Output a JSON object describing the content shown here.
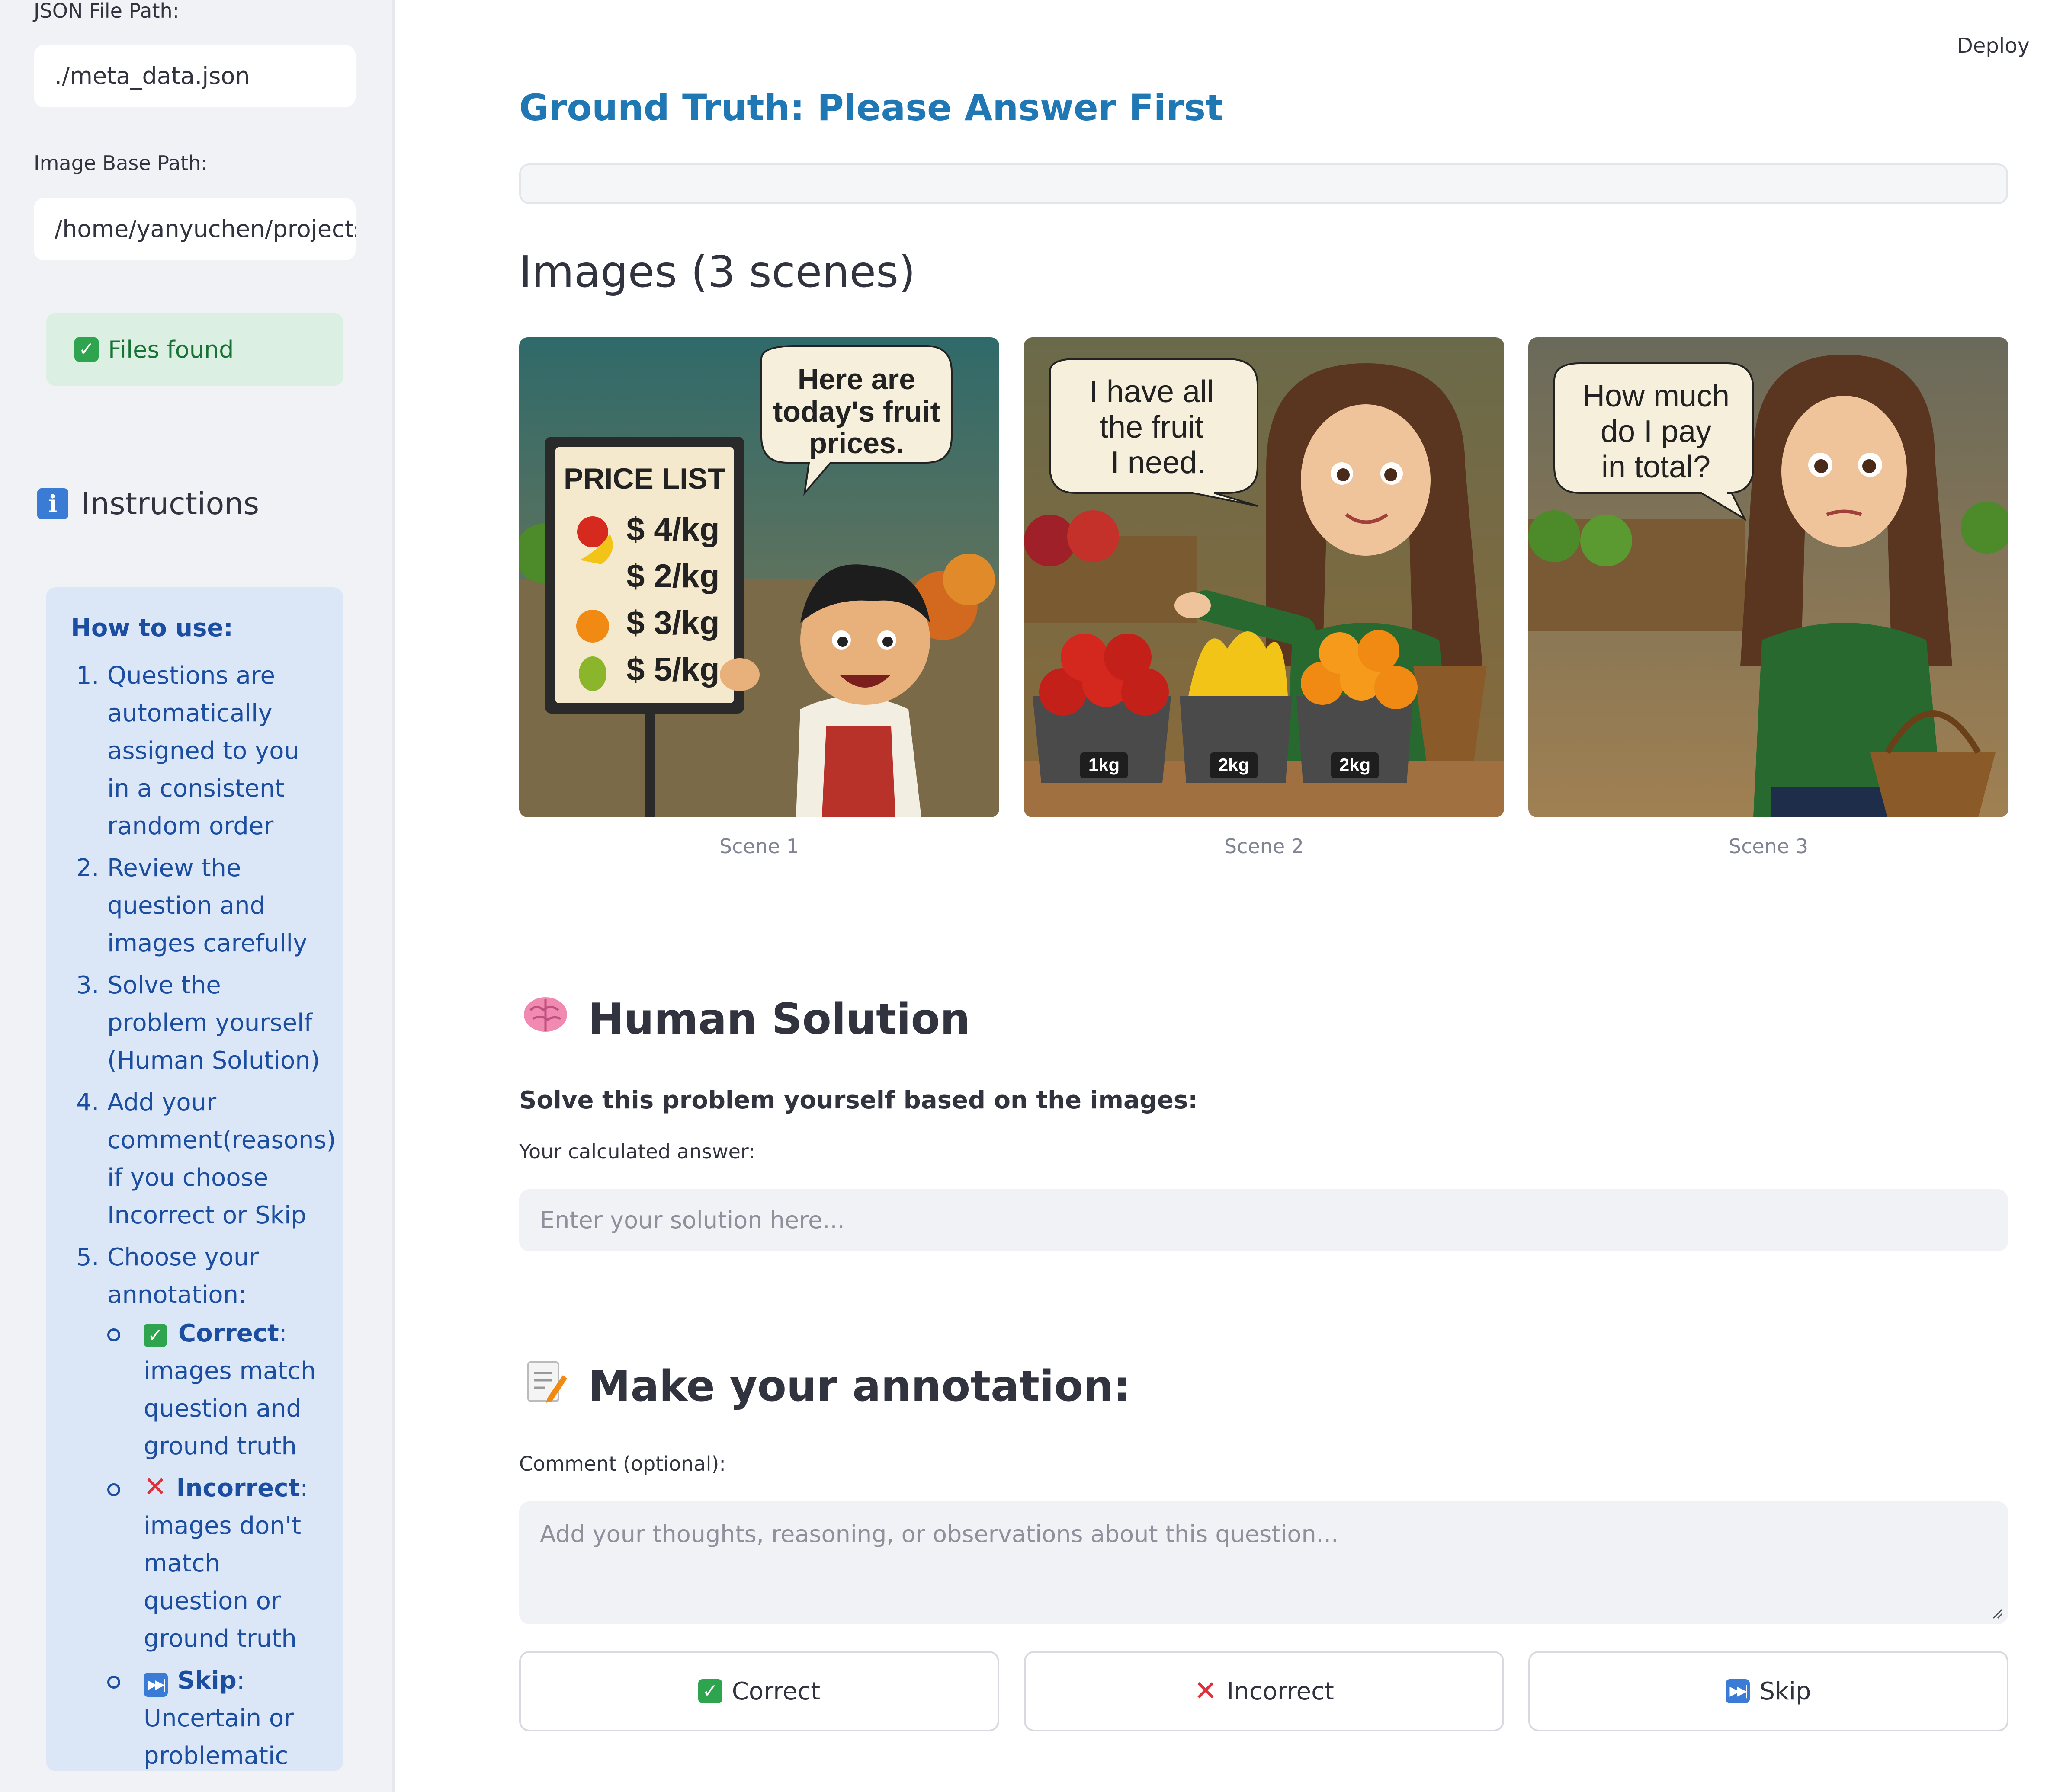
{
  "sidebar": {
    "json_label": "JSON File Path:",
    "json_value": "./meta_data.json",
    "image_label": "Image Base Path:",
    "image_value": "/home/yanyuchen/projects/",
    "files_status": "Files found",
    "instructions_title": "Instructions",
    "how_to_use": "How to use:",
    "steps": [
      "Questions are automatically assigned to you in a consistent random order",
      "Review the question and images carefully",
      "Solve the problem yourself (Human Solution)",
      "Add your comment(reasons) if you choose Incorrect or Skip",
      "Choose your annotation:"
    ],
    "options": [
      {
        "name": "Correct",
        "desc": ": images match question and ground truth"
      },
      {
        "name": "Incorrect",
        "desc": ": images don't match question or ground truth"
      },
      {
        "name": "Skip",
        "desc": ": Uncertain or problematic"
      }
    ]
  },
  "header": {
    "deploy": "Deploy"
  },
  "ground_truth": {
    "title": "Ground Truth: Please Answer First"
  },
  "images": {
    "title": "Images (3 scenes)",
    "scenes": [
      {
        "caption": "Scene 1",
        "bubble": [
          "Here are",
          "today's fruit",
          "prices."
        ],
        "sign_title": "PRICE LIST",
        "prices": [
          "$ 4/kg",
          "$ 2/kg",
          "$ 3/kg",
          "$ 5/kg"
        ]
      },
      {
        "caption": "Scene 2",
        "bubble": [
          "I have all",
          "the fruit",
          "I need."
        ],
        "weights": [
          "1kg",
          "2kg",
          "2kg"
        ]
      },
      {
        "caption": "Scene 3",
        "bubble": [
          "How much",
          "do I pay",
          "in total?"
        ]
      }
    ]
  },
  "human_solution": {
    "title": "Human Solution",
    "prompt": "Solve this problem yourself based on the images:",
    "answer_label": "Your calculated answer:",
    "answer_placeholder": "Enter your solution here..."
  },
  "annotation": {
    "title": "Make your annotation:",
    "comment_label": "Comment (optional):",
    "comment_placeholder": "Add your thoughts, reasoning, or observations about this question...",
    "buttons": {
      "correct": "Correct",
      "incorrect": "Incorrect",
      "skip": "Skip"
    }
  }
}
